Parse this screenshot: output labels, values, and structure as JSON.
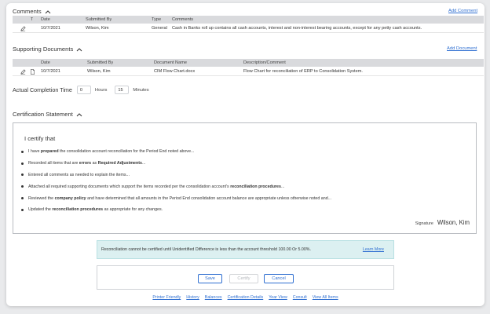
{
  "comments": {
    "title": "Comments",
    "add_link": "Add Comment",
    "headers": {
      "t": "T",
      "date": "Date",
      "submitted_by": "Submitted By",
      "type": "Type",
      "comments": "Comments"
    },
    "rows": [
      {
        "date": "10/7/2021",
        "submitted_by": "Wilson, Kim",
        "type": "General",
        "comment": "Cash in Banks roll up contains all cash accounts, interest and non-interest bearing accounts, except for any petty cash accounts."
      }
    ]
  },
  "supporting_documents": {
    "title": "Supporting Documents",
    "add_link": "Add Document",
    "headers": {
      "date": "Date",
      "submitted_by": "Submitted By",
      "document_name": "Document Name",
      "description": "Description/Comment"
    },
    "rows": [
      {
        "date": "10/7/2021",
        "submitted_by": "Wilson, Kim",
        "document_name": "CIM Flow Chart.docx",
        "description": "Flow Chart for reconciliation of ERP to Consolidation System."
      }
    ]
  },
  "completion_time": {
    "label": "Actual Completion Time",
    "hours_value": "0",
    "hours_label": "Hours",
    "minutes_value": "15",
    "minutes_label": "Minutes"
  },
  "certification": {
    "title": "Certification Statement",
    "heading": "I certify that",
    "statements": [
      {
        "pre": "I have ",
        "bold": "prepared",
        "post": " the consolidation account reconciliation for the Period End noted above..."
      },
      {
        "pre": "Recorded all items that are ",
        "bold": "errors",
        "mid": " as ",
        "bold2": "Required Adjustments",
        "post": "..."
      },
      {
        "pre": "Entered all comments as needed to explain the items...",
        "bold": "",
        "post": ""
      },
      {
        "pre": "Attached all required supporting documents which support the items recorded per the consolidation account's ",
        "bold": "reconciliation procedures",
        "post": "..."
      },
      {
        "pre": "Reviewed the ",
        "bold": "company policy",
        "post": " and have determined that all amounts in the Period End consolidation account balance are appropriate unless otherwise noted and..."
      },
      {
        "pre": "Updated the ",
        "bold": "reconciliation procedures",
        "post": " as appropriate for any changes."
      }
    ],
    "signature_label": "Signature",
    "signature_name": "Wilson, Kim"
  },
  "banner": {
    "message": "Reconciliation cannot be certified until Unidentified Difference is less than the account threshold 100.00 Or 5.00%.",
    "learn_more": "Learn More"
  },
  "buttons": {
    "save": "Save",
    "certify": "Certify",
    "cancel": "Cancel"
  },
  "footer_links": [
    "Printer Friendly",
    "History",
    "Balances",
    "Certification Details",
    "Year View",
    "Consult",
    "View All Items"
  ],
  "colors": {
    "link": "#2f6fd1",
    "header_bg": "#d9dadd",
    "banner_bg": "#dcf0f1"
  }
}
